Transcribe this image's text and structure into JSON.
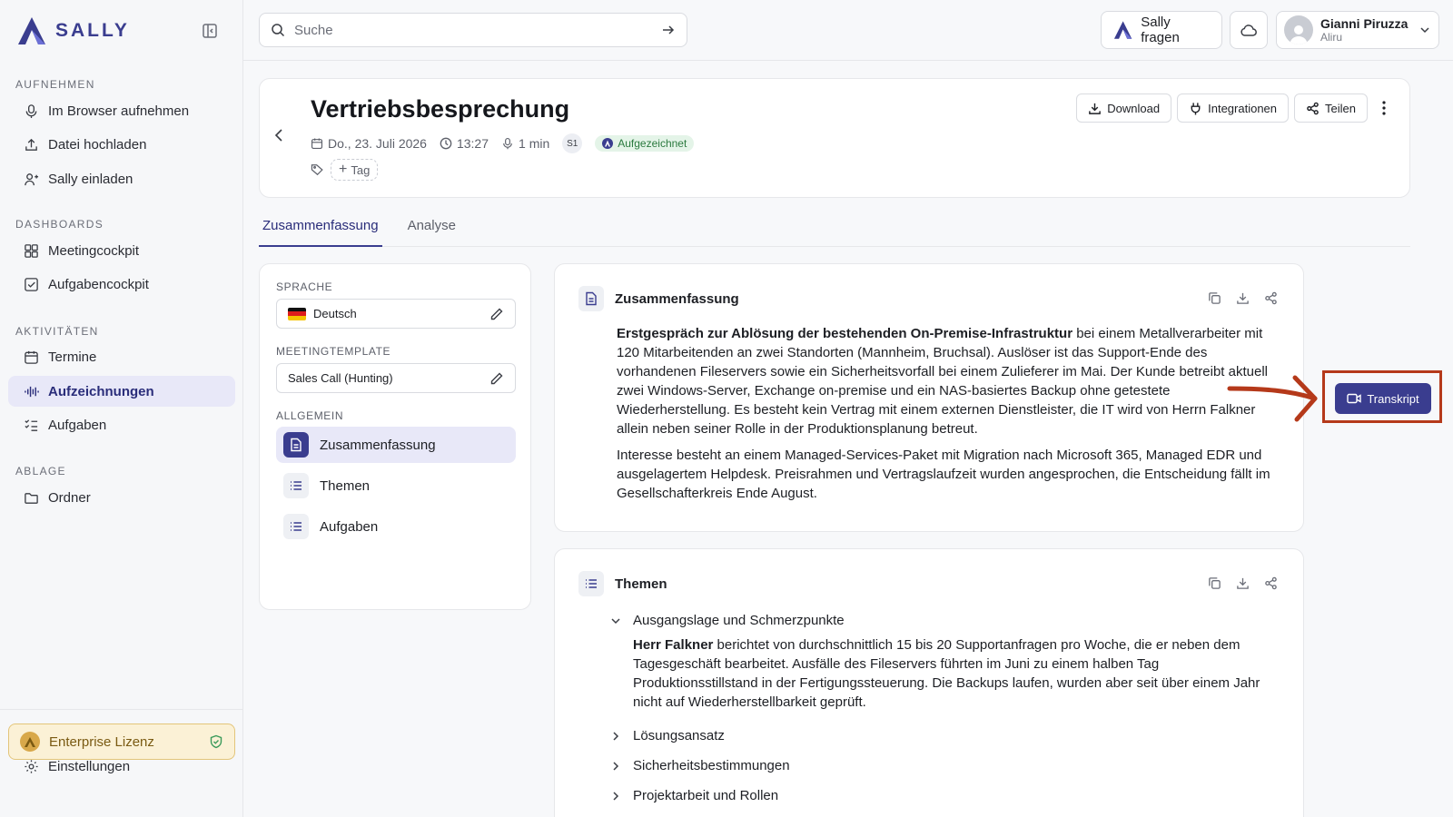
{
  "brand": {
    "name": "SALLY"
  },
  "sidebar": {
    "sections": [
      {
        "title": "AUFNEHMEN",
        "items": [
          "Im Browser aufnehmen",
          "Datei hochladen",
          "Sally einladen"
        ]
      },
      {
        "title": "DASHBOARDS",
        "items": [
          "Meetingcockpit",
          "Aufgabencockpit"
        ]
      },
      {
        "title": "AKTIVITÄTEN",
        "items": [
          "Termine",
          "Aufzeichnungen",
          "Aufgaben"
        ]
      },
      {
        "title": "ABLAGE",
        "items": [
          "Ordner"
        ]
      }
    ],
    "active_item": "Aufzeichnungen",
    "license": "Enterprise Lizenz",
    "settings": "Einstellungen"
  },
  "topbar": {
    "search_placeholder": "Suche",
    "ask_label": "Sally fragen",
    "user_name": "Gianni Piruzza",
    "user_org": "Aliru"
  },
  "meeting": {
    "title": "Vertriebsbesprechung",
    "date": "Do., 23. Juli 2026",
    "time": "13:27",
    "duration": "1 min",
    "speaker": "S1",
    "status": "Aufgezeichnet",
    "tag_label": "Tag",
    "actions": {
      "download": "Download",
      "integrations": "Integrationen",
      "share": "Teilen"
    }
  },
  "tabs": [
    "Zusammenfassung",
    "Analyse"
  ],
  "left_panel": {
    "language_label": "SPRACHE",
    "language_value": "Deutsch",
    "template_label": "MEETINGTEMPLATE",
    "template_value": "Sales Call (Hunting)",
    "general_label": "ALLGEMEIN",
    "items": [
      "Zusammenfassung",
      "Themen",
      "Aufgaben"
    ]
  },
  "summary": {
    "title": "Zusammenfassung",
    "p1_bold": "Erstgespräch zur Ablösung der bestehenden On-Premise-Infrastruktur",
    "p1_rest": " bei einem Metallverarbeiter mit 120 Mitarbeitenden an zwei Standorten (Mannheim, Bruchsal). Auslöser ist das Support-Ende des vorhandenen Fileservers sowie ein Sicherheitsvorfall bei einem Zulieferer im Mai. Der Kunde betreibt aktuell zwei Windows-Server, Exchange on-premise und ein NAS-basiertes Backup ohne getestete Wiederherstellung. Es besteht kein Vertrag mit einem externen Dienstleister, die IT wird von Herrn Falkner allein neben seiner Rolle in der Produktionsplanung betreut.",
    "p2": "Interesse besteht an einem Managed-Services-Paket mit Migration nach Microsoft 365, Managed EDR und ausgelagertem Helpdesk. Preisrahmen und Vertragslaufzeit wurden angesprochen, die Entscheidung fällt im Gesellschafterkreis Ende August."
  },
  "themes": {
    "title": "Themen",
    "topics": [
      {
        "title": "Ausgangslage und Schmerzpunkte",
        "expanded": true,
        "body_bold": "Herr Falkner",
        "body_rest": " berichtet von durchschnittlich 15 bis 20 Supportanfragen pro Woche, die er neben dem Tagesgeschäft bearbeitet. Ausfälle des Fileservers führten im Juni zu einem halben Tag Produktionsstillstand in der Fertigungssteuerung. Die Backups laufen, wurden aber seit über einem Jahr nicht auf Wiederherstellbarkeit geprüft."
      },
      {
        "title": "Lösungsansatz",
        "expanded": false
      },
      {
        "title": "Sicherheitsbestimmungen",
        "expanded": false
      },
      {
        "title": "Projektarbeit und Rollen",
        "expanded": false
      }
    ]
  },
  "transcript_button": "Transkript",
  "colors": {
    "accent": "#3a3d8f",
    "highlight": "#b5391a"
  }
}
